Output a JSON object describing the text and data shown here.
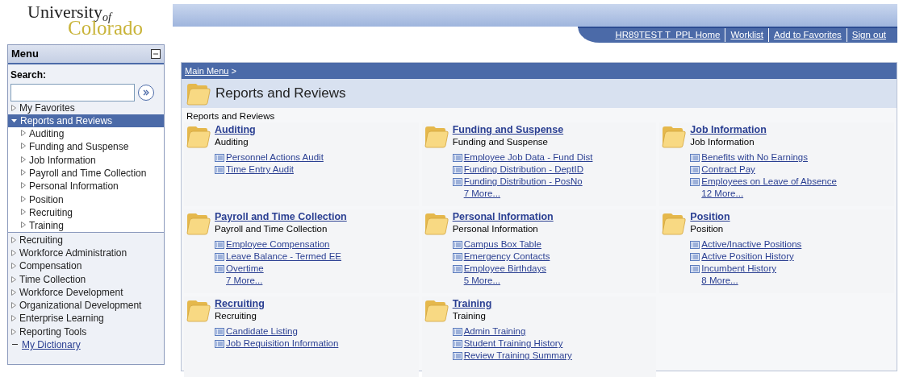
{
  "logo": {
    "line1": "University",
    "sub": "of",
    "line2": "Colorado"
  },
  "header_links": [
    {
      "label": "HR89TEST T  PPL Home"
    },
    {
      "label": "Worklist"
    },
    {
      "label": "Add to Favorites"
    },
    {
      "label": "Sign out"
    }
  ],
  "menu": {
    "title": "Menu",
    "search_label": "Search:",
    "items": [
      {
        "label": "My Favorites",
        "kind": "folder",
        "expanded": false,
        "selected": false
      },
      {
        "label": "Reports and Reviews",
        "kind": "folder",
        "expanded": true,
        "selected": true,
        "children": [
          {
            "label": "Auditing",
            "kind": "folder",
            "expanded": false,
            "selected": false
          },
          {
            "label": "Funding and Suspense",
            "kind": "folder",
            "expanded": false,
            "selected": false
          },
          {
            "label": "Job Information",
            "kind": "folder",
            "expanded": false,
            "selected": false
          },
          {
            "label": "Payroll and Time Collection",
            "kind": "folder",
            "expanded": false,
            "selected": false
          },
          {
            "label": "Personal Information",
            "kind": "folder",
            "expanded": false,
            "selected": false
          },
          {
            "label": "Position",
            "kind": "folder",
            "expanded": false,
            "selected": false
          },
          {
            "label": "Recruiting",
            "kind": "folder",
            "expanded": false,
            "selected": false
          },
          {
            "label": "Training",
            "kind": "folder",
            "expanded": false,
            "selected": false
          }
        ]
      },
      {
        "label": "Recruiting",
        "kind": "folder",
        "expanded": false,
        "selected": false
      },
      {
        "label": "Workforce Administration",
        "kind": "folder",
        "expanded": false,
        "selected": false
      },
      {
        "label": "Compensation",
        "kind": "folder",
        "expanded": false,
        "selected": false
      },
      {
        "label": "Time Collection",
        "kind": "folder",
        "expanded": false,
        "selected": false
      },
      {
        "label": "Workforce Development",
        "kind": "folder",
        "expanded": false,
        "selected": false
      },
      {
        "label": "Organizational Development",
        "kind": "folder",
        "expanded": false,
        "selected": false
      },
      {
        "label": "Enterprise Learning",
        "kind": "folder",
        "expanded": false,
        "selected": false
      },
      {
        "label": "Reporting Tools",
        "kind": "folder",
        "expanded": false,
        "selected": false
      },
      {
        "label": "My Dictionary",
        "kind": "link",
        "selected": false
      }
    ]
  },
  "breadcrumb": {
    "link": "Main Menu",
    "separator": ">"
  },
  "page_title": "Reports and Reviews",
  "section_label": "Reports and Reviews",
  "categories": [
    {
      "title": "Auditing",
      "description": "Auditing",
      "links": [
        "Personnel Actions Audit",
        "Time Entry Audit"
      ]
    },
    {
      "title": "Funding and Suspense",
      "description": "Funding and Suspense",
      "links": [
        "Employee Job Data - Fund Dist",
        "Funding Distribution - DeptID",
        "Funding Distribution - PosNo"
      ],
      "more": "7 More..."
    },
    {
      "title": "Job Information",
      "description": "Job Information",
      "links": [
        "Benefits with No Earnings",
        "Contract Pay",
        "Employees on Leave of Absence"
      ],
      "more": "12 More..."
    },
    {
      "title": "Payroll and Time Collection",
      "description": "Payroll and Time Collection",
      "links": [
        "Employee Compensation",
        "Leave Balance - Termed EE",
        "Overtime"
      ],
      "more": "7 More..."
    },
    {
      "title": "Personal Information",
      "description": "Personal Information",
      "links": [
        "Campus Box Table",
        "Emergency Contacts",
        "Employee Birthdays"
      ],
      "more": "5 More..."
    },
    {
      "title": "Position",
      "description": "Position",
      "links": [
        "Active/Inactive Positions",
        "Active Position History",
        "Incumbent History"
      ],
      "more": "8 More..."
    },
    {
      "title": "Recruiting",
      "description": "Recruiting",
      "links": [
        "Candidate Listing",
        "Job Requisition Information"
      ]
    },
    {
      "title": "Training",
      "description": "Training",
      "links": [
        "Admin Training",
        "Student Training History",
        "Review Training Summary"
      ]
    }
  ]
}
